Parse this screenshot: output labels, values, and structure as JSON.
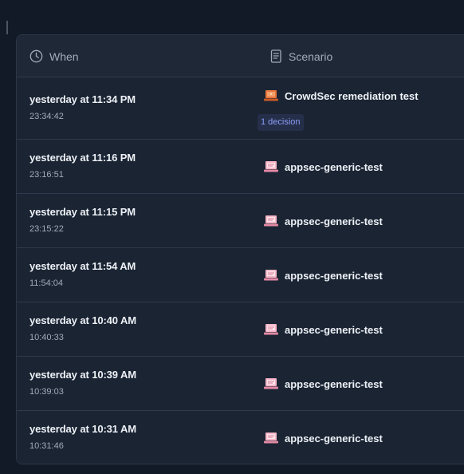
{
  "table": {
    "headers": {
      "when": "When",
      "scenario": "Scenario"
    },
    "rows": [
      {
        "relative": "yesterday at 11:34 PM",
        "time": "23:34:42",
        "scenario": "CrowdSec remediation test",
        "icon": "crowdsec-orange-laptop-icon",
        "badge": "1 decision"
      },
      {
        "relative": "yesterday at 11:16 PM",
        "time": "23:16:51",
        "scenario": "appsec-generic-test",
        "icon": "appsec-pink-laptop-icon"
      },
      {
        "relative": "yesterday at 11:15 PM",
        "time": "23:15:22",
        "scenario": "appsec-generic-test",
        "icon": "appsec-pink-laptop-icon"
      },
      {
        "relative": "yesterday at 11:54 AM",
        "time": "11:54:04",
        "scenario": "appsec-generic-test",
        "icon": "appsec-pink-laptop-icon"
      },
      {
        "relative": "yesterday at 10:40 AM",
        "time": "10:40:33",
        "scenario": "appsec-generic-test",
        "icon": "appsec-pink-laptop-icon"
      },
      {
        "relative": "yesterday at 10:39 AM",
        "time": "10:39:03",
        "scenario": "appsec-generic-test",
        "icon": "appsec-pink-laptop-icon"
      },
      {
        "relative": "yesterday at 10:31 AM",
        "time": "10:31:46",
        "scenario": "appsec-generic-test",
        "icon": "appsec-pink-laptop-icon"
      }
    ]
  },
  "colors": {
    "background": "#121a27",
    "card": "#1a2433",
    "badge_bg": "#252f4a",
    "badge_text": "#8b9cf5",
    "icon_orange": "#e8743b",
    "icon_pink": "#f6b6c8"
  }
}
